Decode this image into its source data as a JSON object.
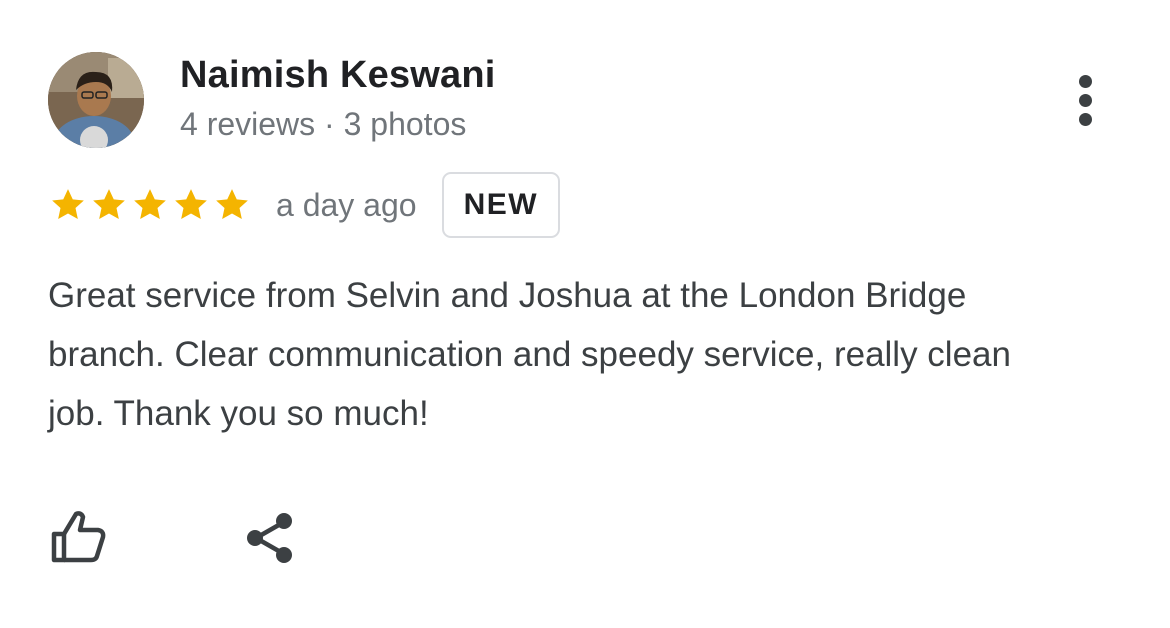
{
  "review": {
    "author": {
      "name": "Naimish Keswani",
      "meta": "4 reviews · 3 photos",
      "avatar_icon": "user-photo"
    },
    "rating": 5,
    "rating_max": 5,
    "time": "a day ago",
    "badge": "NEW",
    "text": "Great service from Selvin and Joshua at the London Bridge branch. Clear communication and speedy service, really clean job. Thank you so much!",
    "star_color": "#f4b400"
  },
  "actions": {
    "more_icon": "more-vert-icon",
    "like_icon": "thumb-up-outline-icon",
    "share_icon": "share-icon"
  }
}
